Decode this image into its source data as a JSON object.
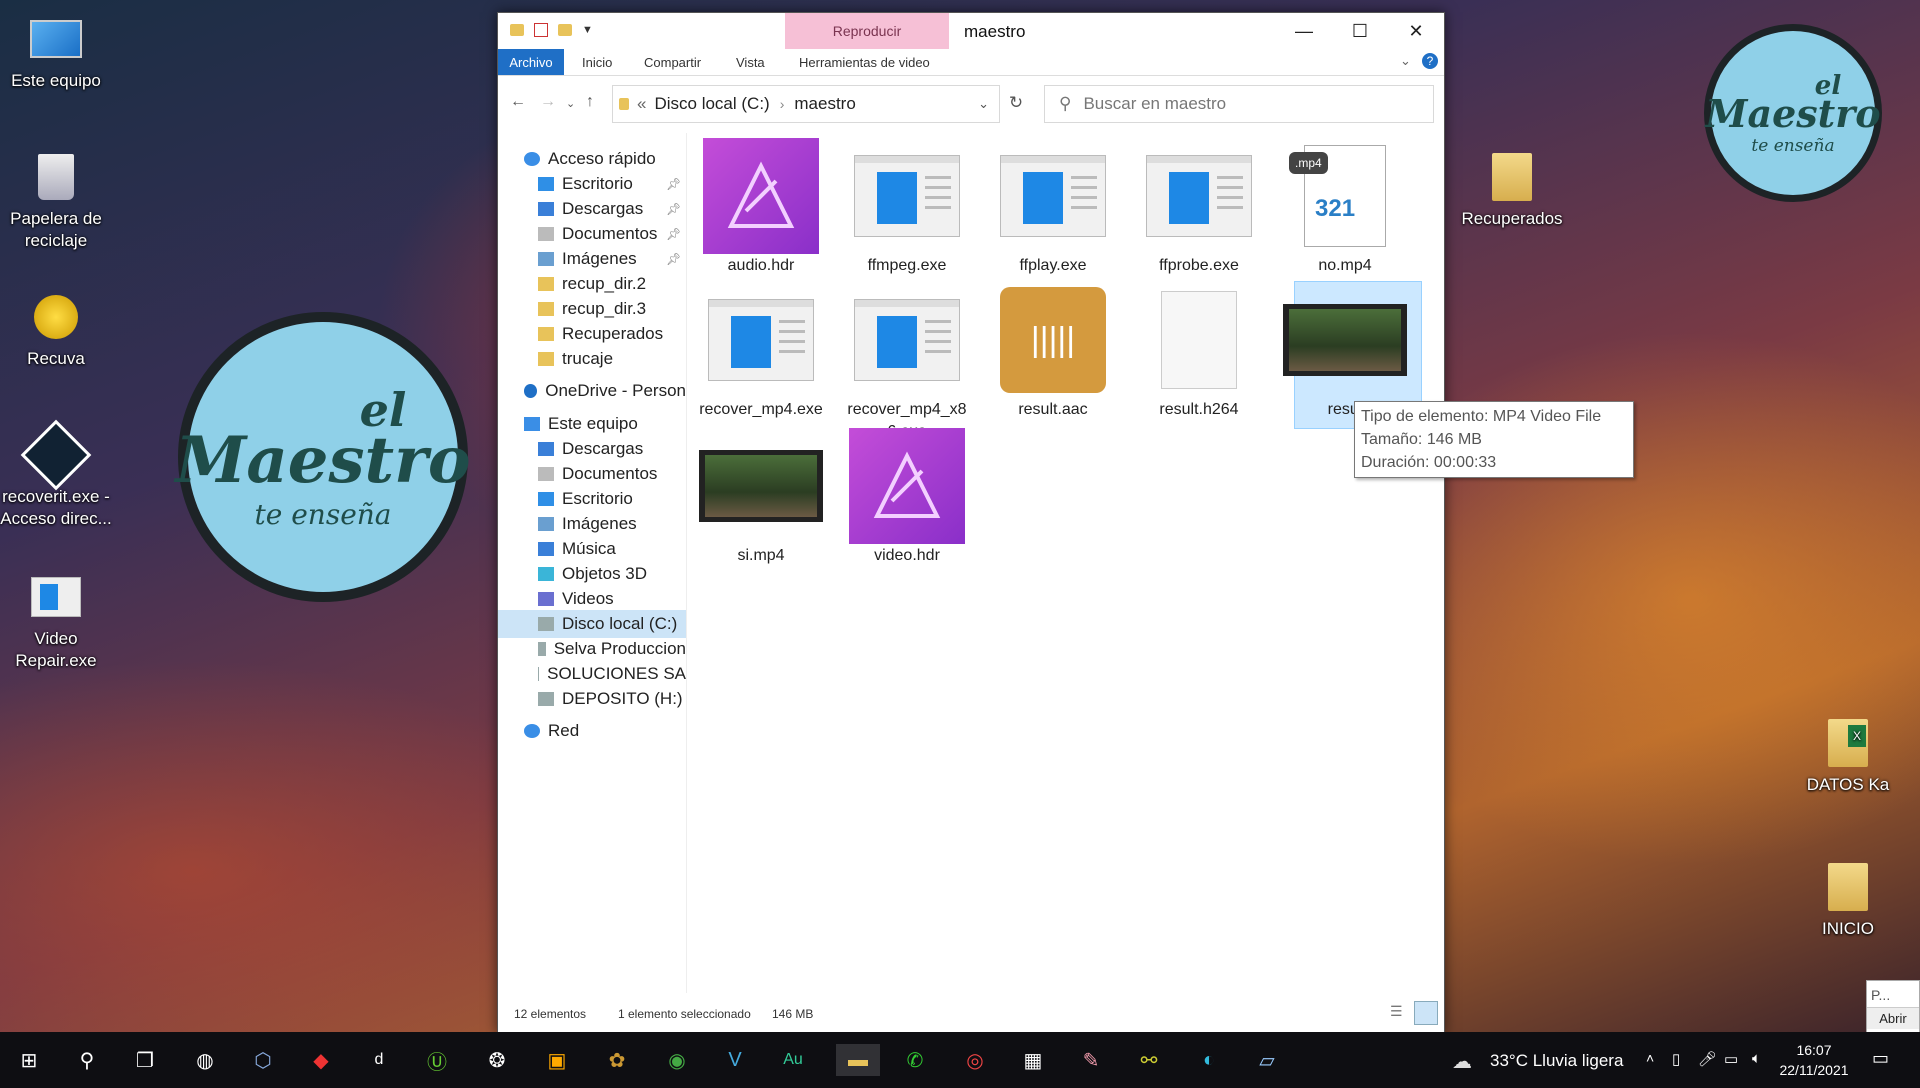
{
  "desktop": {
    "icons_left": [
      {
        "label": "Este equipo",
        "icon": "monitor-icon"
      },
      {
        "label": "Papelera de reciclaje",
        "icon": "recycle-bin-icon"
      },
      {
        "label": "Recuva",
        "icon": "recuva-icon"
      },
      {
        "label": "recoverit.exe - Acceso direc...",
        "icon": "recoverit-icon"
      },
      {
        "label": "Video Repair.exe",
        "icon": "exe-icon"
      }
    ],
    "icons_right": [
      {
        "label": "Recuperados",
        "icon": "folder-icon"
      },
      {
        "label": "DATOS Ka",
        "icon": "excel-folder-icon"
      },
      {
        "label": "INICIO",
        "icon": "folder-icon"
      }
    ],
    "logo_line1": "el",
    "logo_line2": "Maestro",
    "logo_line3": "te enseña",
    "side_popup": {
      "text": "P...",
      "button": "Abrir"
    }
  },
  "window": {
    "title": "maestro",
    "context_tab": "Reproducir",
    "ribbon_tabs": [
      "Archivo",
      "Inicio",
      "Compartir",
      "Vista",
      "Herramientas de video"
    ],
    "address": {
      "root_marker": "«",
      "path": [
        "Disco local (C:)",
        "maestro"
      ]
    },
    "search_placeholder": "Buscar en maestro",
    "nav": [
      {
        "label": "Acceso rápido",
        "icon": "star-icon",
        "indent": 0
      },
      {
        "label": "Escritorio",
        "icon": "desktop-icon",
        "indent": 1,
        "pinned": true
      },
      {
        "label": "Descargas",
        "icon": "download-icon",
        "indent": 1,
        "pinned": true
      },
      {
        "label": "Documentos",
        "icon": "document-icon",
        "indent": 1,
        "pinned": true
      },
      {
        "label": "Imágenes",
        "icon": "image-icon",
        "indent": 1,
        "pinned": true
      },
      {
        "label": "recup_dir.2",
        "icon": "folder-icon",
        "indent": 1
      },
      {
        "label": "recup_dir.3",
        "icon": "folder-icon",
        "indent": 1
      },
      {
        "label": "Recuperados",
        "icon": "folder-icon",
        "indent": 1
      },
      {
        "label": "trucaje",
        "icon": "folder-icon",
        "indent": 1
      },
      {
        "label": "OneDrive - Person",
        "icon": "cloud-icon",
        "indent": 0
      },
      {
        "label": "Este equipo",
        "icon": "monitor-icon",
        "indent": 0
      },
      {
        "label": "Descargas",
        "icon": "download-icon",
        "indent": 1
      },
      {
        "label": "Documentos",
        "icon": "document-icon",
        "indent": 1
      },
      {
        "label": "Escritorio",
        "icon": "desktop-icon",
        "indent": 1
      },
      {
        "label": "Imágenes",
        "icon": "image-icon",
        "indent": 1
      },
      {
        "label": "Música",
        "icon": "music-icon",
        "indent": 1
      },
      {
        "label": "Objetos 3D",
        "icon": "cube-icon",
        "indent": 1
      },
      {
        "label": "Videos",
        "icon": "video-icon",
        "indent": 1
      },
      {
        "label": "Disco local (C:)",
        "icon": "drive-icon",
        "indent": 1,
        "selected": true
      },
      {
        "label": "Selva Produccion",
        "icon": "drive-icon",
        "indent": 1
      },
      {
        "label": "SOLUCIONES SA",
        "icon": "drive-icon",
        "indent": 1
      },
      {
        "label": "DEPOSITO (H:)",
        "icon": "drive-icon",
        "indent": 1
      },
      {
        "label": "Red",
        "icon": "network-icon",
        "indent": 0
      }
    ],
    "files": [
      {
        "name": "audio.hdr",
        "kind": "affinity"
      },
      {
        "name": "ffmpeg.exe",
        "kind": "exe"
      },
      {
        "name": "ffplay.exe",
        "kind": "exe"
      },
      {
        "name": "ffprobe.exe",
        "kind": "exe"
      },
      {
        "name": "no.mp4",
        "kind": "mp4doc",
        "badge": ".mp4",
        "badge2": "321"
      },
      {
        "name": "recover_mp4.exe",
        "kind": "exe"
      },
      {
        "name": "recover_mp4_x86.exe",
        "kind": "exe"
      },
      {
        "name": "result.aac",
        "kind": "aac"
      },
      {
        "name": "result.h264",
        "kind": "blank"
      },
      {
        "name": "resul",
        "kind": "video",
        "selected": true
      },
      {
        "name": "si.mp4",
        "kind": "video"
      },
      {
        "name": "video.hdr",
        "kind": "affinity"
      }
    ],
    "tooltip": [
      "Tipo de elemento: MP4 Video File",
      "Tamaño: 146 MB",
      "Duración: 00:00:33"
    ],
    "status": {
      "count": "12 elementos",
      "selection": "1 elemento seleccionado",
      "size": "146 MB"
    }
  },
  "taskbar": {
    "weather": "33°C  Lluvia ligera",
    "time": "16:07",
    "date": "22/11/2021"
  }
}
